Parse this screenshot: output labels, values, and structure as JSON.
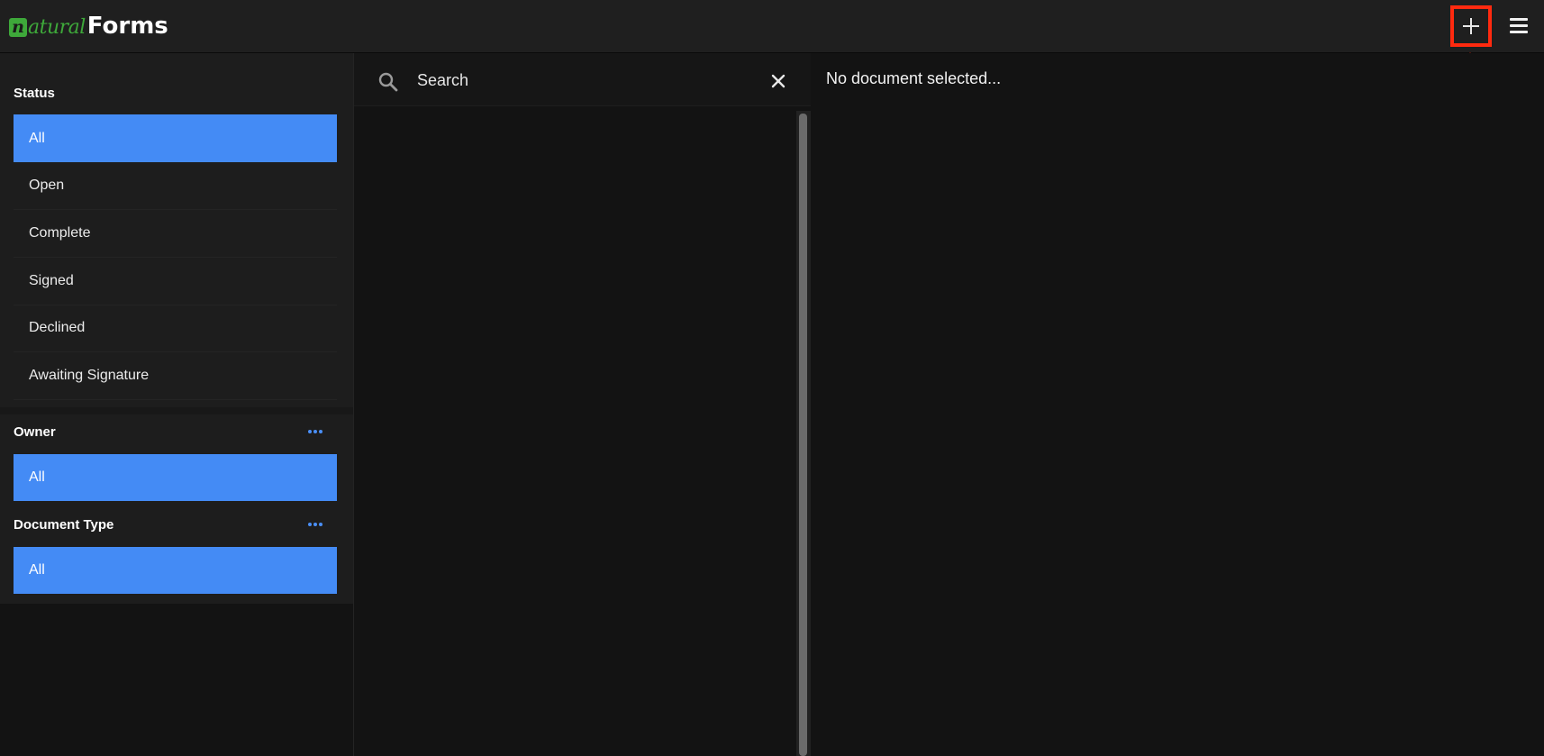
{
  "app": {
    "logo_mark": "n",
    "logo_natural": "atural",
    "logo_forms": "Forms"
  },
  "header": {
    "add_icon": "plus-icon",
    "menu_icon": "hamburger-menu-icon",
    "highlight_color": "#ff2a0f"
  },
  "sidebar": {
    "status": {
      "title": "Status",
      "items": [
        {
          "label": "All",
          "selected": true
        },
        {
          "label": "Open",
          "selected": false
        },
        {
          "label": "Complete",
          "selected": false
        },
        {
          "label": "Signed",
          "selected": false
        },
        {
          "label": "Declined",
          "selected": false
        },
        {
          "label": "Awaiting Signature",
          "selected": false
        }
      ]
    },
    "owner": {
      "title": "Owner",
      "more_icon": "more-horizontal-icon",
      "selected": "All"
    },
    "document_type": {
      "title": "Document Type",
      "more_icon": "more-horizontal-icon",
      "selected": "All"
    }
  },
  "list": {
    "search": {
      "placeholder": "Search",
      "value": "",
      "search_icon": "search-icon",
      "clear_icon": "close-icon"
    }
  },
  "detail": {
    "empty_message": "No document selected..."
  },
  "colors": {
    "accent": "#448bf5",
    "brand_green": "#3ea83a",
    "annotation_red": "#ff2a0f"
  }
}
